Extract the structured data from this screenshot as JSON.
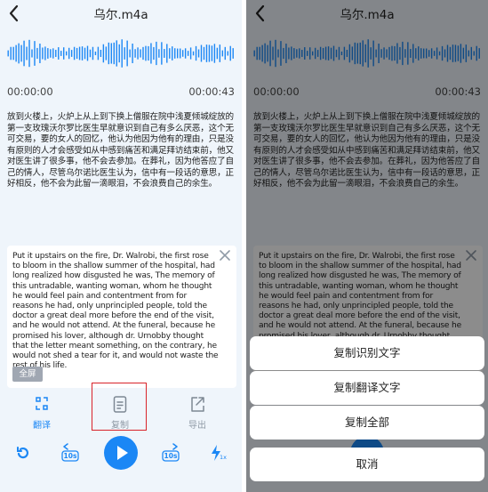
{
  "header": {
    "title": "乌尔.m4a"
  },
  "player": {
    "time_start": "00:00:00",
    "time_end": "00:00:43",
    "skip_back": "10s",
    "skip_forward": "10s",
    "speed_suffix": "1x"
  },
  "transcript": "放到火楼上，火炉上从上到下换上僧服在院中浅夏倾城绽放的第一支玫瑰沃尔罗比医生早就意识到自己有多么厌恶，这个无可交易，要的女人的回忆，他认为他因为他有的理由，只是没有原则的人才会感受如从中感到痛苦和满足拜访结束前，他又对医生讲了很多事，他不会去参加。在葬礼，因为他答应了自己的情人，尽管乌尔诺比医生认为，信中有一段话的意思，正好相反，他不会为此留一滴眼泪，不会浪费自己的余生。",
  "translation": {
    "text": "Put it upstairs on the fire, Dr. Walrobi, the first rose to bloom in the shallow summer of the hospital, had long realized how disgusted he was, The memory of this untradable, wanting woman, whom he thought he would feel pain and contentment from for reasons he had, only unprincipled people, told the doctor a great deal more before the end of the visit, and he would not attend. At the funeral, because he promised his lover, although dr. Urnobby thought that the letter meant something, on the contrary, he would not shed a tear for it, and would not waste the rest of his life.",
    "fullscreen_label": "全屏"
  },
  "actions": {
    "translate_label": "翻译",
    "copy_label": "复制",
    "export_label": "导出"
  },
  "sheet": {
    "copy_recognized": "复制识别文字",
    "copy_translation": "复制翻译文字",
    "copy_all": "复制全部",
    "cancel": "取消"
  },
  "colors": {
    "accent": "#1b87f5",
    "highlight_frame": "#d8232a",
    "muted": "#8f9aa6"
  }
}
